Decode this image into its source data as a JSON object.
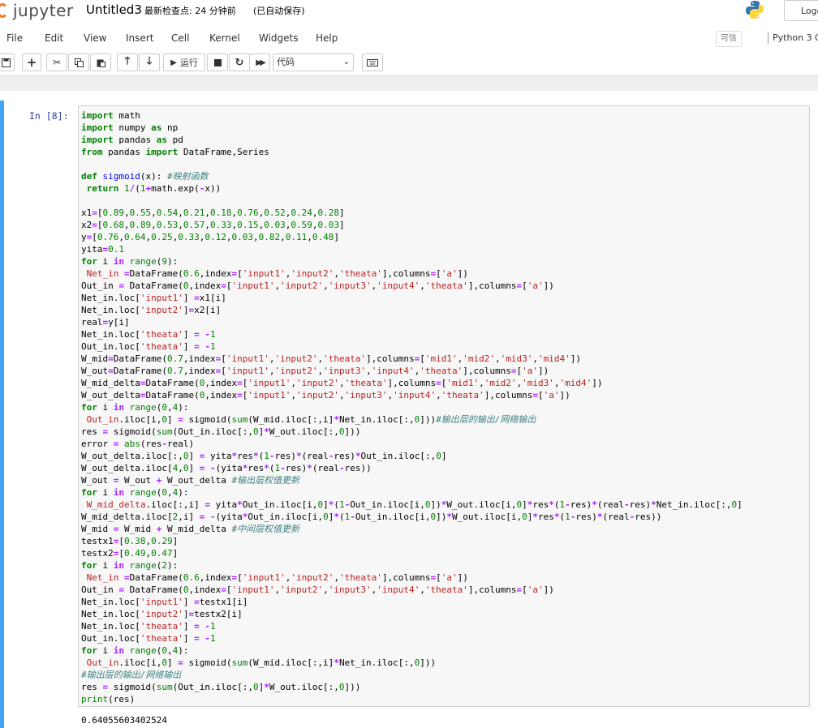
{
  "header": {
    "logo_text": "jupyter",
    "notebook_title": "Untitled3",
    "checkpoint": "最新检查点: 24 分钟前",
    "autosave": "(已自动保存)",
    "logout_label": "Logout"
  },
  "menu": {
    "items": [
      "File",
      "Edit",
      "View",
      "Insert",
      "Cell",
      "Kernel",
      "Widgets",
      "Help"
    ],
    "trusted": "可信",
    "kernel_name": "Python 3",
    "kernel_indicator": "C"
  },
  "toolbar": {
    "run_label": "运行",
    "cell_type": "代码"
  },
  "cell": {
    "prompt": "In  [8]:",
    "output": "0.64055603402524"
  },
  "colors": {
    "accent_cell_border": "#42a5f5",
    "jupyter_orange": "#f37726",
    "prompt_blue": "#303f9f"
  }
}
